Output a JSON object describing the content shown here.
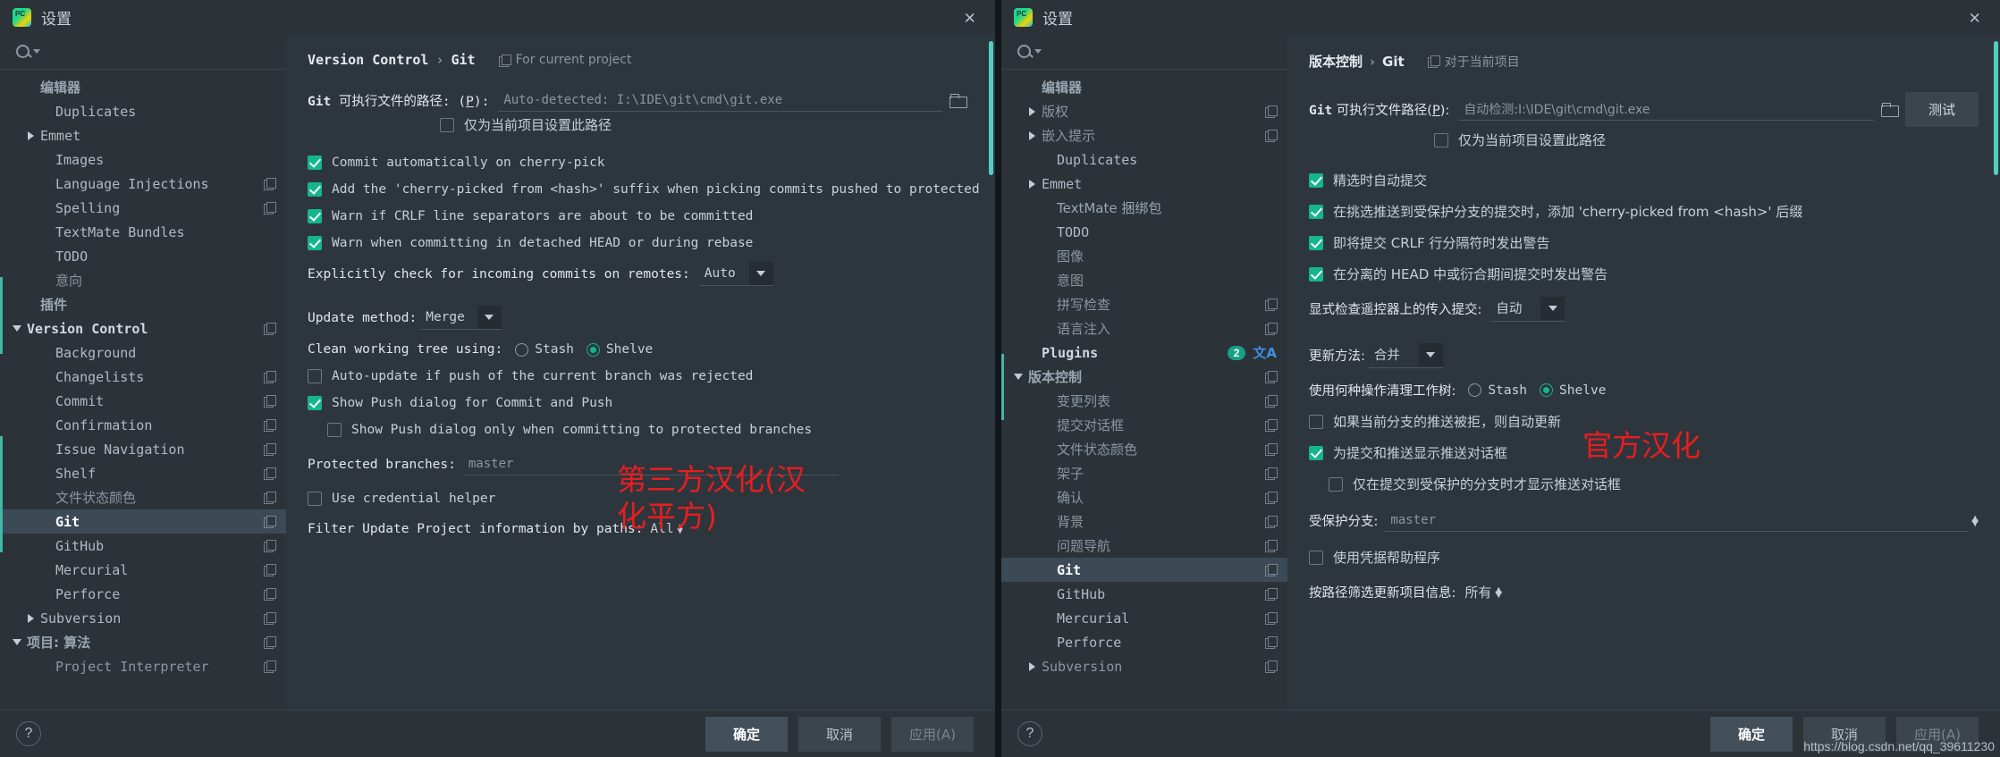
{
  "left_window": {
    "title": "设置",
    "close_label": "✕",
    "search_placeholder": "",
    "search_value": "",
    "tree": [
      {
        "label": "编辑器",
        "indent": 1,
        "arrow": "none",
        "style": "cjk bold",
        "copy": false
      },
      {
        "label": "Duplicates",
        "indent": 2,
        "arrow": "none",
        "style": "",
        "copy": false
      },
      {
        "label": "Emmet",
        "indent": 1,
        "arrow": "right",
        "style": "",
        "copy": false
      },
      {
        "label": "Images",
        "indent": 2,
        "arrow": "none",
        "style": "",
        "copy": false
      },
      {
        "label": "Language Injections",
        "indent": 2,
        "arrow": "none",
        "style": "",
        "copy": true
      },
      {
        "label": "Spelling",
        "indent": 2,
        "arrow": "none",
        "style": "",
        "copy": true
      },
      {
        "label": "TextMate Bundles",
        "indent": 2,
        "arrow": "none",
        "style": "",
        "copy": false
      },
      {
        "label": "TODO",
        "indent": 2,
        "arrow": "none",
        "style": "",
        "copy": false
      },
      {
        "label": "意向",
        "indent": 2,
        "arrow": "none",
        "style": "cjk dim",
        "copy": false
      },
      {
        "label": "插件",
        "indent": 1,
        "arrow": "none",
        "style": "cjk bold",
        "copy": false
      },
      {
        "label": "Version Control",
        "indent": 0,
        "arrow": "down",
        "style": "bold",
        "copy": true
      },
      {
        "label": "Background",
        "indent": 2,
        "arrow": "none",
        "style": "",
        "copy": false
      },
      {
        "label": "Changelists",
        "indent": 2,
        "arrow": "none",
        "style": "",
        "copy": true
      },
      {
        "label": "Commit",
        "indent": 2,
        "arrow": "none",
        "style": "",
        "copy": true
      },
      {
        "label": "Confirmation",
        "indent": 2,
        "arrow": "none",
        "style": "",
        "copy": true
      },
      {
        "label": "Issue Navigation",
        "indent": 2,
        "arrow": "none",
        "style": "",
        "copy": true
      },
      {
        "label": "Shelf",
        "indent": 2,
        "arrow": "none",
        "style": "",
        "copy": true
      },
      {
        "label": "文件状态颜色",
        "indent": 2,
        "arrow": "none",
        "style": "cjk dim",
        "copy": true
      },
      {
        "label": "Git",
        "indent": 2,
        "arrow": "none",
        "style": "sel",
        "copy": true
      },
      {
        "label": "GitHub",
        "indent": 2,
        "arrow": "none",
        "style": "",
        "copy": true
      },
      {
        "label": "Mercurial",
        "indent": 2,
        "arrow": "none",
        "style": "",
        "copy": true
      },
      {
        "label": "Perforce",
        "indent": 2,
        "arrow": "none",
        "style": "",
        "copy": true
      },
      {
        "label": "Subversion",
        "indent": 1,
        "arrow": "right",
        "style": "",
        "copy": true
      },
      {
        "label": "项目: 算法",
        "indent": 0,
        "arrow": "down",
        "style": "cjk bold",
        "copy": true
      },
      {
        "label": "Project Interpreter",
        "indent": 2,
        "arrow": "none",
        "style": "dim",
        "copy": true
      }
    ],
    "breadcrumb": {
      "root": "Version Control",
      "sep": "›",
      "leaf": "Git",
      "note": "For current project"
    },
    "git_path": {
      "label_prefix": "Git",
      "label_text": " 可执行文件的路径: (",
      "mnemonic": "P",
      "label_suffix": "):",
      "value": "Auto-detected: I:\\IDE\\git\\cmd\\git.exe"
    },
    "project_only_checkbox": {
      "label": "仅为当前项目设置此路径",
      "checked": false
    },
    "options": [
      {
        "label": "Commit automatically on cherry-pick",
        "checked": true,
        "indent": 0
      },
      {
        "label": "Add the 'cherry-picked from <hash>' suffix when picking commits pushed to protected",
        "checked": true,
        "indent": 0
      },
      {
        "label": "Warn if CRLF line separators are about to be committed",
        "checked": true,
        "indent": 0
      },
      {
        "label": "Warn when committing in detached HEAD or during rebase",
        "checked": true,
        "indent": 0
      }
    ],
    "incoming": {
      "label": "Explicitly check for incoming commits on remotes:",
      "value": "Auto"
    },
    "update_method": {
      "label": "Update method:",
      "value": "Merge"
    },
    "clean_tree": {
      "label": "Clean working tree using:",
      "opt1": "Stash",
      "opt2": "Shelve",
      "selected": "Shelve"
    },
    "auto_update": {
      "label": "Auto-update if push of the current branch was rejected",
      "checked": false
    },
    "show_push": {
      "label": "Show Push dialog for Commit and Push",
      "checked": true
    },
    "show_push_protected": {
      "label": "Show Push dialog only when committing to protected branches",
      "checked": false
    },
    "protected_branches": {
      "label": "Protected branches:",
      "value": "master"
    },
    "cred_helper": {
      "label": "Use credential helper",
      "checked": false
    },
    "filter_paths": {
      "label": "Filter Update Project information by paths:",
      "value": "All"
    },
    "annotation": "第三方汉化(汉化平方)",
    "buttons": {
      "ok": "确定",
      "cancel": "取消",
      "apply": "应用(A)"
    },
    "help": "?"
  },
  "right_window": {
    "title": "设置",
    "close_label": "✕",
    "search_placeholder": "",
    "search_value": "",
    "tree": [
      {
        "label": "编辑器",
        "indent": 1,
        "arrow": "none",
        "style": "cjk bold",
        "copy": false,
        "badge": "",
        "trans": false
      },
      {
        "label": "版权",
        "indent": 1,
        "arrow": "right",
        "style": "cjk dim",
        "copy": true,
        "badge": "",
        "trans": false
      },
      {
        "label": "嵌入提示",
        "indent": 1,
        "arrow": "right",
        "style": "cjk dim",
        "copy": true,
        "badge": "",
        "trans": false
      },
      {
        "label": "Duplicates",
        "indent": 2,
        "arrow": "none",
        "style": "",
        "copy": false,
        "badge": "",
        "trans": false
      },
      {
        "label": "Emmet",
        "indent": 1,
        "arrow": "right",
        "style": "",
        "copy": false,
        "badge": "",
        "trans": false
      },
      {
        "label": "TextMate 捆绑包",
        "indent": 2,
        "arrow": "none",
        "style": "cjk",
        "copy": false,
        "badge": "",
        "trans": false
      },
      {
        "label": "TODO",
        "indent": 2,
        "arrow": "none",
        "style": "",
        "copy": false,
        "badge": "",
        "trans": false
      },
      {
        "label": "图像",
        "indent": 2,
        "arrow": "none",
        "style": "cjk dim",
        "copy": false,
        "badge": "",
        "trans": false
      },
      {
        "label": "意图",
        "indent": 2,
        "arrow": "none",
        "style": "cjk dim",
        "copy": false,
        "badge": "",
        "trans": false
      },
      {
        "label": "拼写检查",
        "indent": 2,
        "arrow": "none",
        "style": "cjk dim",
        "copy": true,
        "badge": "",
        "trans": false
      },
      {
        "label": "语言注入",
        "indent": 2,
        "arrow": "none",
        "style": "cjk dim",
        "copy": true,
        "badge": "",
        "trans": false
      },
      {
        "label": "Plugins",
        "indent": 1,
        "arrow": "none",
        "style": "bold",
        "copy": false,
        "badge": "2",
        "trans": true
      },
      {
        "label": "版本控制",
        "indent": 0,
        "arrow": "down",
        "style": "cjk bold",
        "copy": true,
        "badge": "",
        "trans": false
      },
      {
        "label": "变更列表",
        "indent": 2,
        "arrow": "none",
        "style": "cjk dim",
        "copy": true,
        "badge": "",
        "trans": false
      },
      {
        "label": "提交对话框",
        "indent": 2,
        "arrow": "none",
        "style": "cjk dim",
        "copy": true,
        "badge": "",
        "trans": false
      },
      {
        "label": "文件状态颜色",
        "indent": 2,
        "arrow": "none",
        "style": "cjk dim",
        "copy": true,
        "badge": "",
        "trans": false
      },
      {
        "label": "架子",
        "indent": 2,
        "arrow": "none",
        "style": "cjk dim",
        "copy": true,
        "badge": "",
        "trans": false
      },
      {
        "label": "确认",
        "indent": 2,
        "arrow": "none",
        "style": "cjk dim",
        "copy": true,
        "badge": "",
        "trans": false
      },
      {
        "label": "背景",
        "indent": 2,
        "arrow": "none",
        "style": "cjk dim",
        "copy": true,
        "badge": "",
        "trans": false
      },
      {
        "label": "问题导航",
        "indent": 2,
        "arrow": "none",
        "style": "cjk dim",
        "copy": true,
        "badge": "",
        "trans": false
      },
      {
        "label": "Git",
        "indent": 2,
        "arrow": "none",
        "style": "sel",
        "copy": true,
        "badge": "",
        "trans": false
      },
      {
        "label": "GitHub",
        "indent": 2,
        "arrow": "none",
        "style": "",
        "copy": true,
        "badge": "",
        "trans": false
      },
      {
        "label": "Mercurial",
        "indent": 2,
        "arrow": "none",
        "style": "",
        "copy": true,
        "badge": "",
        "trans": false
      },
      {
        "label": "Perforce",
        "indent": 2,
        "arrow": "none",
        "style": "",
        "copy": true,
        "badge": "",
        "trans": false
      },
      {
        "label": "Subversion",
        "indent": 1,
        "arrow": "right",
        "style": "dim",
        "copy": true,
        "badge": "",
        "trans": false
      }
    ],
    "breadcrumb": {
      "root": "版本控制",
      "sep": "›",
      "leaf": "Git",
      "note": "对于当前项目"
    },
    "git_path": {
      "label_prefix": "Git",
      "label_text": " 可执行文件路径(",
      "mnemonic": "P",
      "label_suffix": "):",
      "value": "自动检测:I:\\IDE\\git\\cmd\\git.exe",
      "test_button": "测试"
    },
    "project_only_checkbox": {
      "label": "仅为当前项目设置此路径",
      "checked": false
    },
    "options": [
      {
        "label": "精选时自动提交",
        "checked": true
      },
      {
        "label": "在挑选推送到受保护分支的提交时，添加 'cherry-picked from <hash>' 后缀",
        "checked": true
      },
      {
        "label": "即将提交 CRLF 行分隔符时发出警告",
        "checked": true
      },
      {
        "label": "在分离的 HEAD 中或衍合期间提交时发出警告",
        "checked": true
      }
    ],
    "incoming": {
      "label": "显式检查遥控器上的传入提交:",
      "value": "自动"
    },
    "update_method": {
      "label": "更新方法:",
      "value": "合并"
    },
    "clean_tree": {
      "label": "使用何种操作清理工作树:",
      "opt1": "Stash",
      "opt2": "Shelve",
      "selected": "Shelve"
    },
    "auto_update": {
      "label": "如果当前分支的推送被拒，则自动更新",
      "checked": false
    },
    "show_push": {
      "label": "为提交和推送显示推送对话框",
      "checked": true
    },
    "show_push_protected": {
      "label": "仅在提交到受保护的分支时才显示推送对话框",
      "checked": false
    },
    "protected_branches": {
      "label": "受保护分支:",
      "value": "master"
    },
    "cred_helper": {
      "label": "使用凭据帮助程序",
      "checked": false
    },
    "filter_paths": {
      "label": "按路径筛选更新项目信息:",
      "value": "所有"
    },
    "annotation": "官方汉化",
    "buttons": {
      "ok": "确定",
      "cancel": "取消",
      "apply": "应用(A)"
    },
    "help": "?",
    "watermark": "https://blog.csdn.net/qq_39611230"
  },
  "colors": {
    "accent": "#14b68b",
    "annotation_red": "#e81d20",
    "window_bg": "#2b3238",
    "content_bg": "#2e363d",
    "selection": "#3c4a56"
  }
}
